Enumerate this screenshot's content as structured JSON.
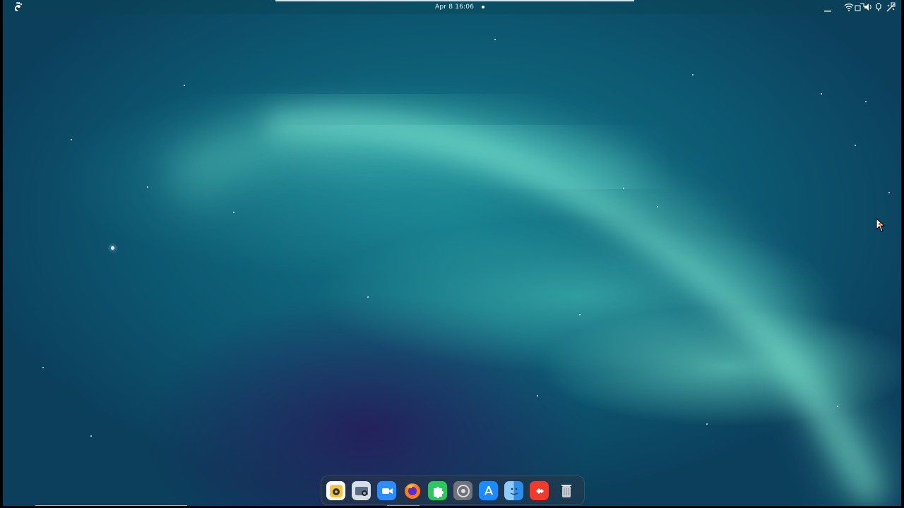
{
  "topbar": {
    "clock": "Apr 8  16:06",
    "icons": [
      "gnome-foot-icon",
      "minimize-icon",
      "wifi-icon",
      "screen-icon",
      "volume-icon",
      "power-icon",
      "settings-icon"
    ]
  },
  "dock": {
    "items": [
      {
        "name": "rhythmbox-icon",
        "color": "#f2b530"
      },
      {
        "name": "screenshot-icon",
        "color": "#7b8ea8"
      },
      {
        "name": "zoom-icon",
        "color": "#2d8cff"
      },
      {
        "name": "firefox-icon",
        "color": "#ff6f1f"
      },
      {
        "name": "extensions-icon",
        "color": "#2ec75f"
      },
      {
        "name": "system-settings-icon",
        "color": "#8a8f96"
      },
      {
        "name": "app-store-icon",
        "color": "#1a8cff"
      },
      {
        "name": "finder-icon",
        "color": "#2f8fe8"
      },
      {
        "name": "anydesk-icon",
        "color": "#ef3b2c"
      },
      {
        "name": "trash-icon",
        "color": "#b8bcc2"
      }
    ]
  }
}
